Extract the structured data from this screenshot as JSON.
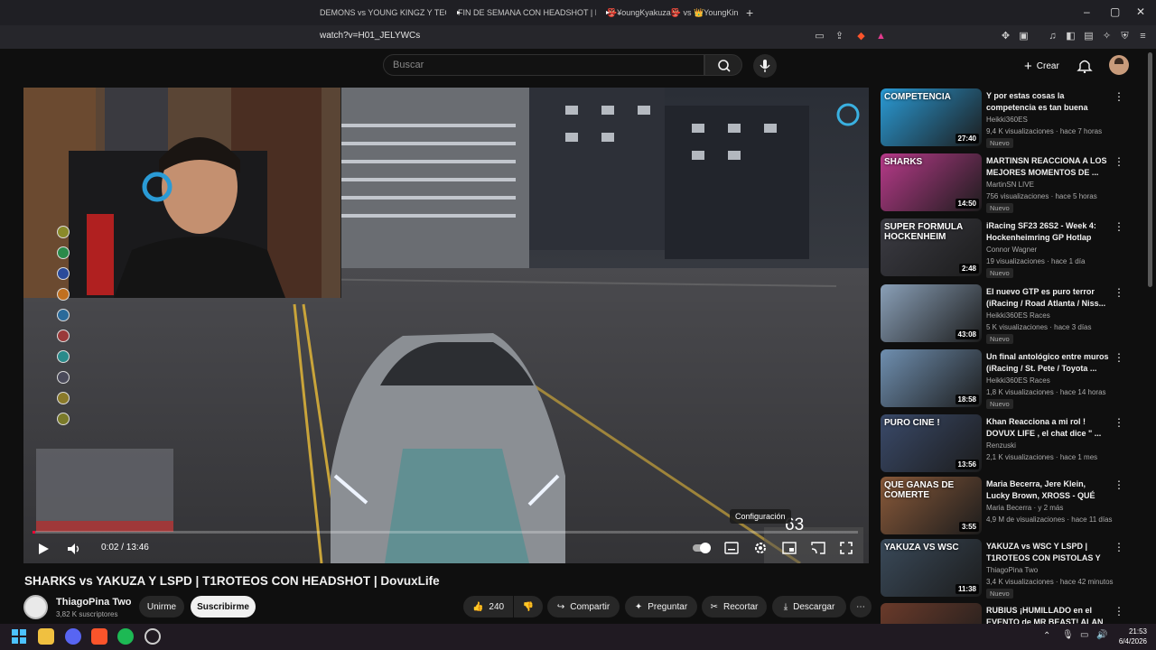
{
  "browser": {
    "tabs": [
      {
        "label": "DEMONS vs YOUNG KINGZ Y TECHO"
      },
      {
        "label": "FIN DE SEMANA CON HEADSHOT | D"
      },
      {
        "label": "👺¥oungKyakuza👺 vs 👑YoungKing"
      }
    ],
    "url": "watch?v=H01_JELYWCs"
  },
  "youtube": {
    "search_placeholder": "Buscar",
    "create_label": "Crear"
  },
  "player": {
    "time": "0:02 / 13:46",
    "progress_fraction": 0.003,
    "tooltip": "Configuración",
    "hud_speed": "63"
  },
  "video": {
    "title": "SHARKS vs YAKUZA Y LSPD | T1ROTEOS CON HEADSHOT | DovuxLife",
    "channel": "ThiagoPina Two",
    "subscribers": "3,82 K suscriptores",
    "join_label": "Unirme",
    "subscribe_label": "Suscribirme",
    "likes": "240",
    "share_label": "Compartir",
    "ask_label": "Preguntar",
    "clip_label": "Recortar",
    "download_label": "Descargar"
  },
  "recommendations": [
    {
      "title": "Y por estas cosas la competencia es tan buena",
      "channel": "Heikki360ES",
      "meta": "9,4 K visualizaciones · hace 7 horas",
      "duration": "27:40",
      "badge": "Nuevo",
      "thumb_text": "COMPETENCIA",
      "color": "#2a9bd6"
    },
    {
      "title": "MARTINSN REACCIONA A LOS MEJORES MOMENTOS DE ...",
      "channel": "MartinSN LIVE",
      "meta": "756 visualizaciones · hace 5 horas",
      "duration": "14:50",
      "badge": "Nuevo",
      "thumb_text": "SHARKS",
      "color": "#b83a8a"
    },
    {
      "title": "iRacing SF23 26S2 - Week 4: Hockenheimring GP Hotlap",
      "channel": "Connor Wagner",
      "meta": "19 visualizaciones · hace 1 día",
      "duration": "2:48",
      "badge": "Nuevo",
      "thumb_text": "SUPER FORMULA HOCKENHEIM",
      "color": "#3c3c44"
    },
    {
      "title": "El nuevo GTP es puro terror (iRacing / Road Atlanta / Niss...",
      "channel": "Heikki360ES Races",
      "meta": "5 K visualizaciones · hace 3 días",
      "duration": "43:08",
      "badge": "Nuevo",
      "thumb_text": "",
      "color": "#8aa0b8"
    },
    {
      "title": "Un final antológico entre muros (iRacing / St. Pete / Toyota ...",
      "channel": "Heikki360ES Races",
      "meta": "1,8 K visualizaciones · hace 14 horas",
      "duration": "18:58",
      "badge": "Nuevo",
      "thumb_text": "",
      "color": "#6f8fb0"
    },
    {
      "title": "Khan Reacciona a mi rol ! DOVUX LIFE , el chat dice \" ...",
      "channel": "Renzuski",
      "meta": "2,1 K visualizaciones · hace 1 mes",
      "duration": "13:56",
      "badge": "",
      "thumb_text": "PURO CINE !",
      "color": "#3a4a6a"
    },
    {
      "title": "Maria Becerra, Jere Klein, Lucky Brown, XROSS - QUÉ GANAS D...",
      "channel": "Maria Becerra · y 2 más",
      "meta": "4,9 M de visualizaciones · hace 11 días",
      "duration": "3:55",
      "badge": "",
      "thumb_text": "QUE GANAS DE COMERTE",
      "color": "#8a5a3a"
    },
    {
      "title": "YAKUZA vs WSC Y LSPD | T1ROTEOS CON PISTOLAS Y ...",
      "channel": "ThiagoPina Two",
      "meta": "3,4 K visualizaciones · hace 42 minutos",
      "duration": "11:38",
      "badge": "Nuevo",
      "thumb_text": "YAKUZA VS WSC",
      "color": "#3a4a5a"
    },
    {
      "title": "RUBIUS ¡HUMILLADO en el EVENTO de MR BEAST! ALAN ...",
      "channel": "",
      "meta": "",
      "duration": "",
      "badge": "",
      "thumb_text": "",
      "color": "#6a3a2a"
    }
  ],
  "taskbar": {
    "time": "21:53",
    "date": "6/4/2026"
  }
}
